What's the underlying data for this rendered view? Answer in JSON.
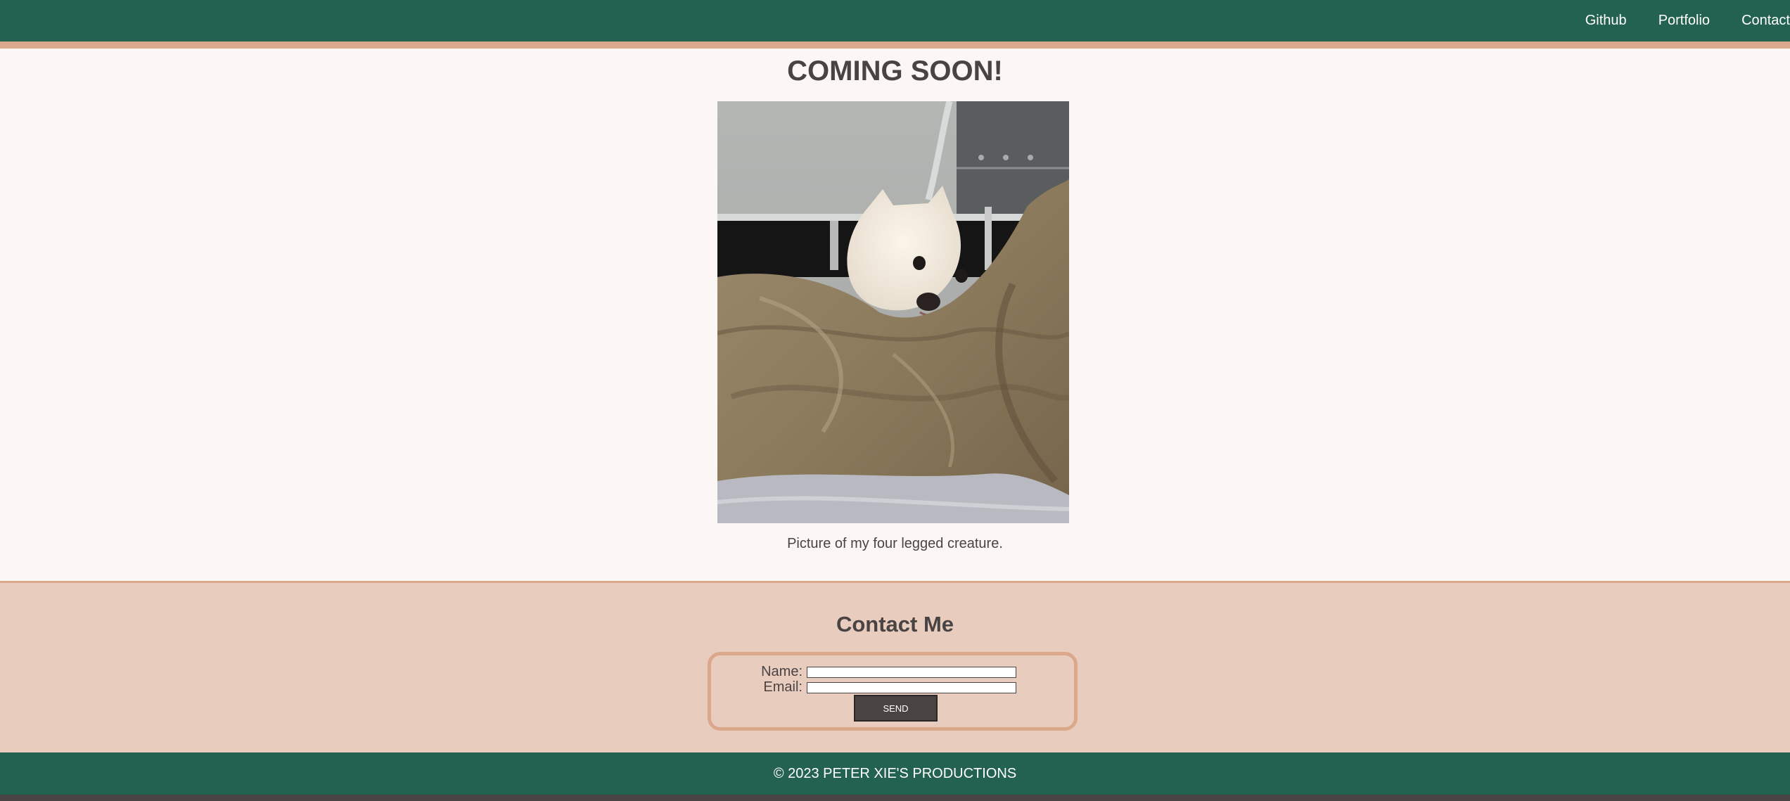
{
  "colors": {
    "header_bg": "#246250",
    "accent": "#dba88b",
    "page_bg": "#fcf7f4",
    "contact_bg": "#e8cdbf",
    "text": "#4a4343",
    "button_bg": "#4a4343"
  },
  "nav": {
    "items": [
      {
        "label": "Github"
      },
      {
        "label": "Portfolio"
      },
      {
        "label": "Contact"
      }
    ]
  },
  "main": {
    "headline": "COMING SOON!",
    "caption": "Picture of my four legged creature."
  },
  "contact": {
    "title": "Contact Me",
    "name_label": "Name:",
    "name_value": "",
    "email_label": "Email:",
    "email_value": "",
    "send_label": "SEND"
  },
  "footer": {
    "text": "© 2023 PETER XIE'S PRODUCTIONS"
  }
}
